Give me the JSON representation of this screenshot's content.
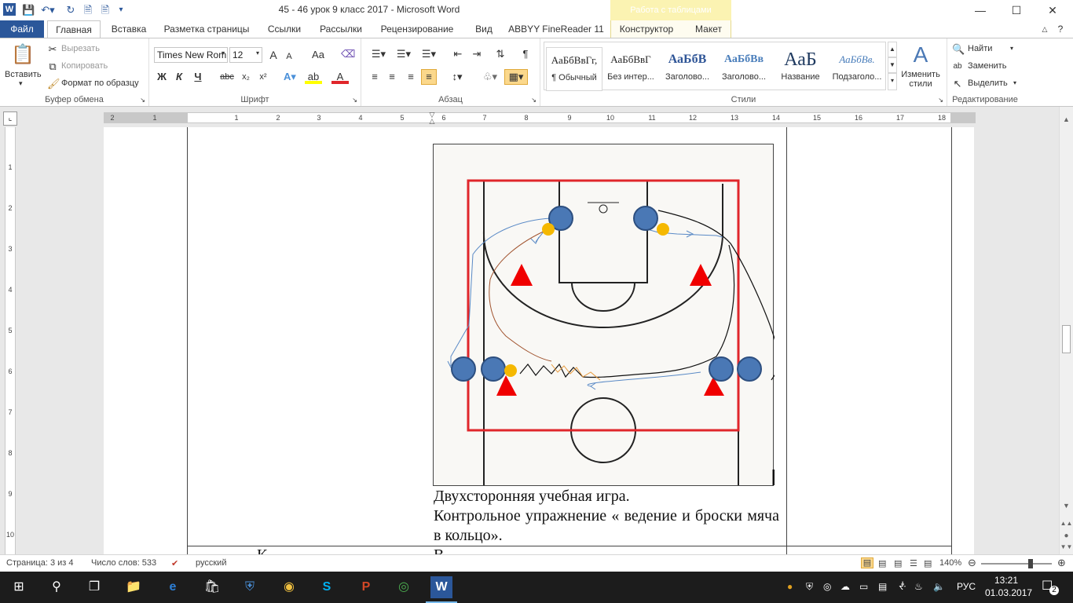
{
  "window": {
    "title": "45 - 46 урок 9 класс 2017  -  Microsoft Word",
    "context_tab_header": "Работа с таблицами",
    "controls": {
      "help": "?",
      "minimize": "—",
      "maximize": "☐",
      "close": "✕"
    }
  },
  "tabs": [
    "Файл",
    "Главная",
    "Вставка",
    "Разметка страницы",
    "Ссылки",
    "Рассылки",
    "Рецензирование",
    "Вид",
    "ABBYY FineReader 11",
    "Конструктор",
    "Макет"
  ],
  "ribbon": {
    "clipboard": {
      "paste": "Вставить",
      "cut": "Вырезать",
      "copy": "Копировать",
      "format_painter": "Формат по образцу",
      "label": "Буфер обмена"
    },
    "font": {
      "name": "Times New Rom",
      "size": "12",
      "bold": "Ж",
      "italic": "К",
      "underline": "Ч",
      "strike": "abc",
      "subscript": "x₂",
      "superscript": "x²",
      "grow": "A",
      "shrink": "A",
      "case": "Aa",
      "label": "Шрифт"
    },
    "paragraph": {
      "label": "Абзац",
      "marks": "¶"
    },
    "styles": {
      "items": [
        {
          "sample": "АаБбВвГг,",
          "name": "¶ Обычный"
        },
        {
          "sample": "АаБбВвГ",
          "name": "Без интер..."
        },
        {
          "sample": "АаБбВ",
          "name": "Заголово..."
        },
        {
          "sample": "АаБбВв",
          "name": "Заголово..."
        },
        {
          "sample": "АаБ",
          "name": "Название"
        },
        {
          "sample": "АаБбВв.",
          "name": "Подзаголо..."
        }
      ],
      "change_styles": "Изменить стили",
      "label": "Стили"
    },
    "editing": {
      "find": "Найти",
      "replace": "Заменить",
      "select": "Выделить",
      "label": "Редактирование"
    }
  },
  "ruler": {
    "horizontal": [
      "2",
      "1",
      "1",
      "2",
      "3",
      "4",
      "5",
      "6",
      "7",
      "8",
      "9",
      "10",
      "11",
      "12",
      "13",
      "14",
      "15",
      "16",
      "17",
      "18"
    ],
    "vertical": [
      "1",
      "2",
      "3",
      "4",
      "5",
      "6",
      "7",
      "8",
      "9",
      "10",
      "11"
    ]
  },
  "document": {
    "text_lines": [
      "Двухсторонняя учебная игра.",
      "Контрольное упражнение « ведение и броски мяча в кольцо»."
    ],
    "next_row_left": "К",
    "next_row_mid": "В"
  },
  "diagram_colors": {
    "court_boundary": "#e0262b",
    "player": "#4a78b5",
    "ball": "#f5b800",
    "cone": "#f00000",
    "path_blue": "#5a8ac6",
    "path_brown": "#a0522d",
    "path_black": "#111111",
    "path_orange": "#e89a3c"
  },
  "statusbar": {
    "page": "Страница: 3 из 4",
    "words": "Число слов: 533",
    "language": "русский",
    "zoom": "140%",
    "zoom_level_fraction": 0.72
  },
  "taskbar": {
    "time": "13:21",
    "date": "01.03.2017",
    "lang": "РУС",
    "notifications": "2"
  }
}
